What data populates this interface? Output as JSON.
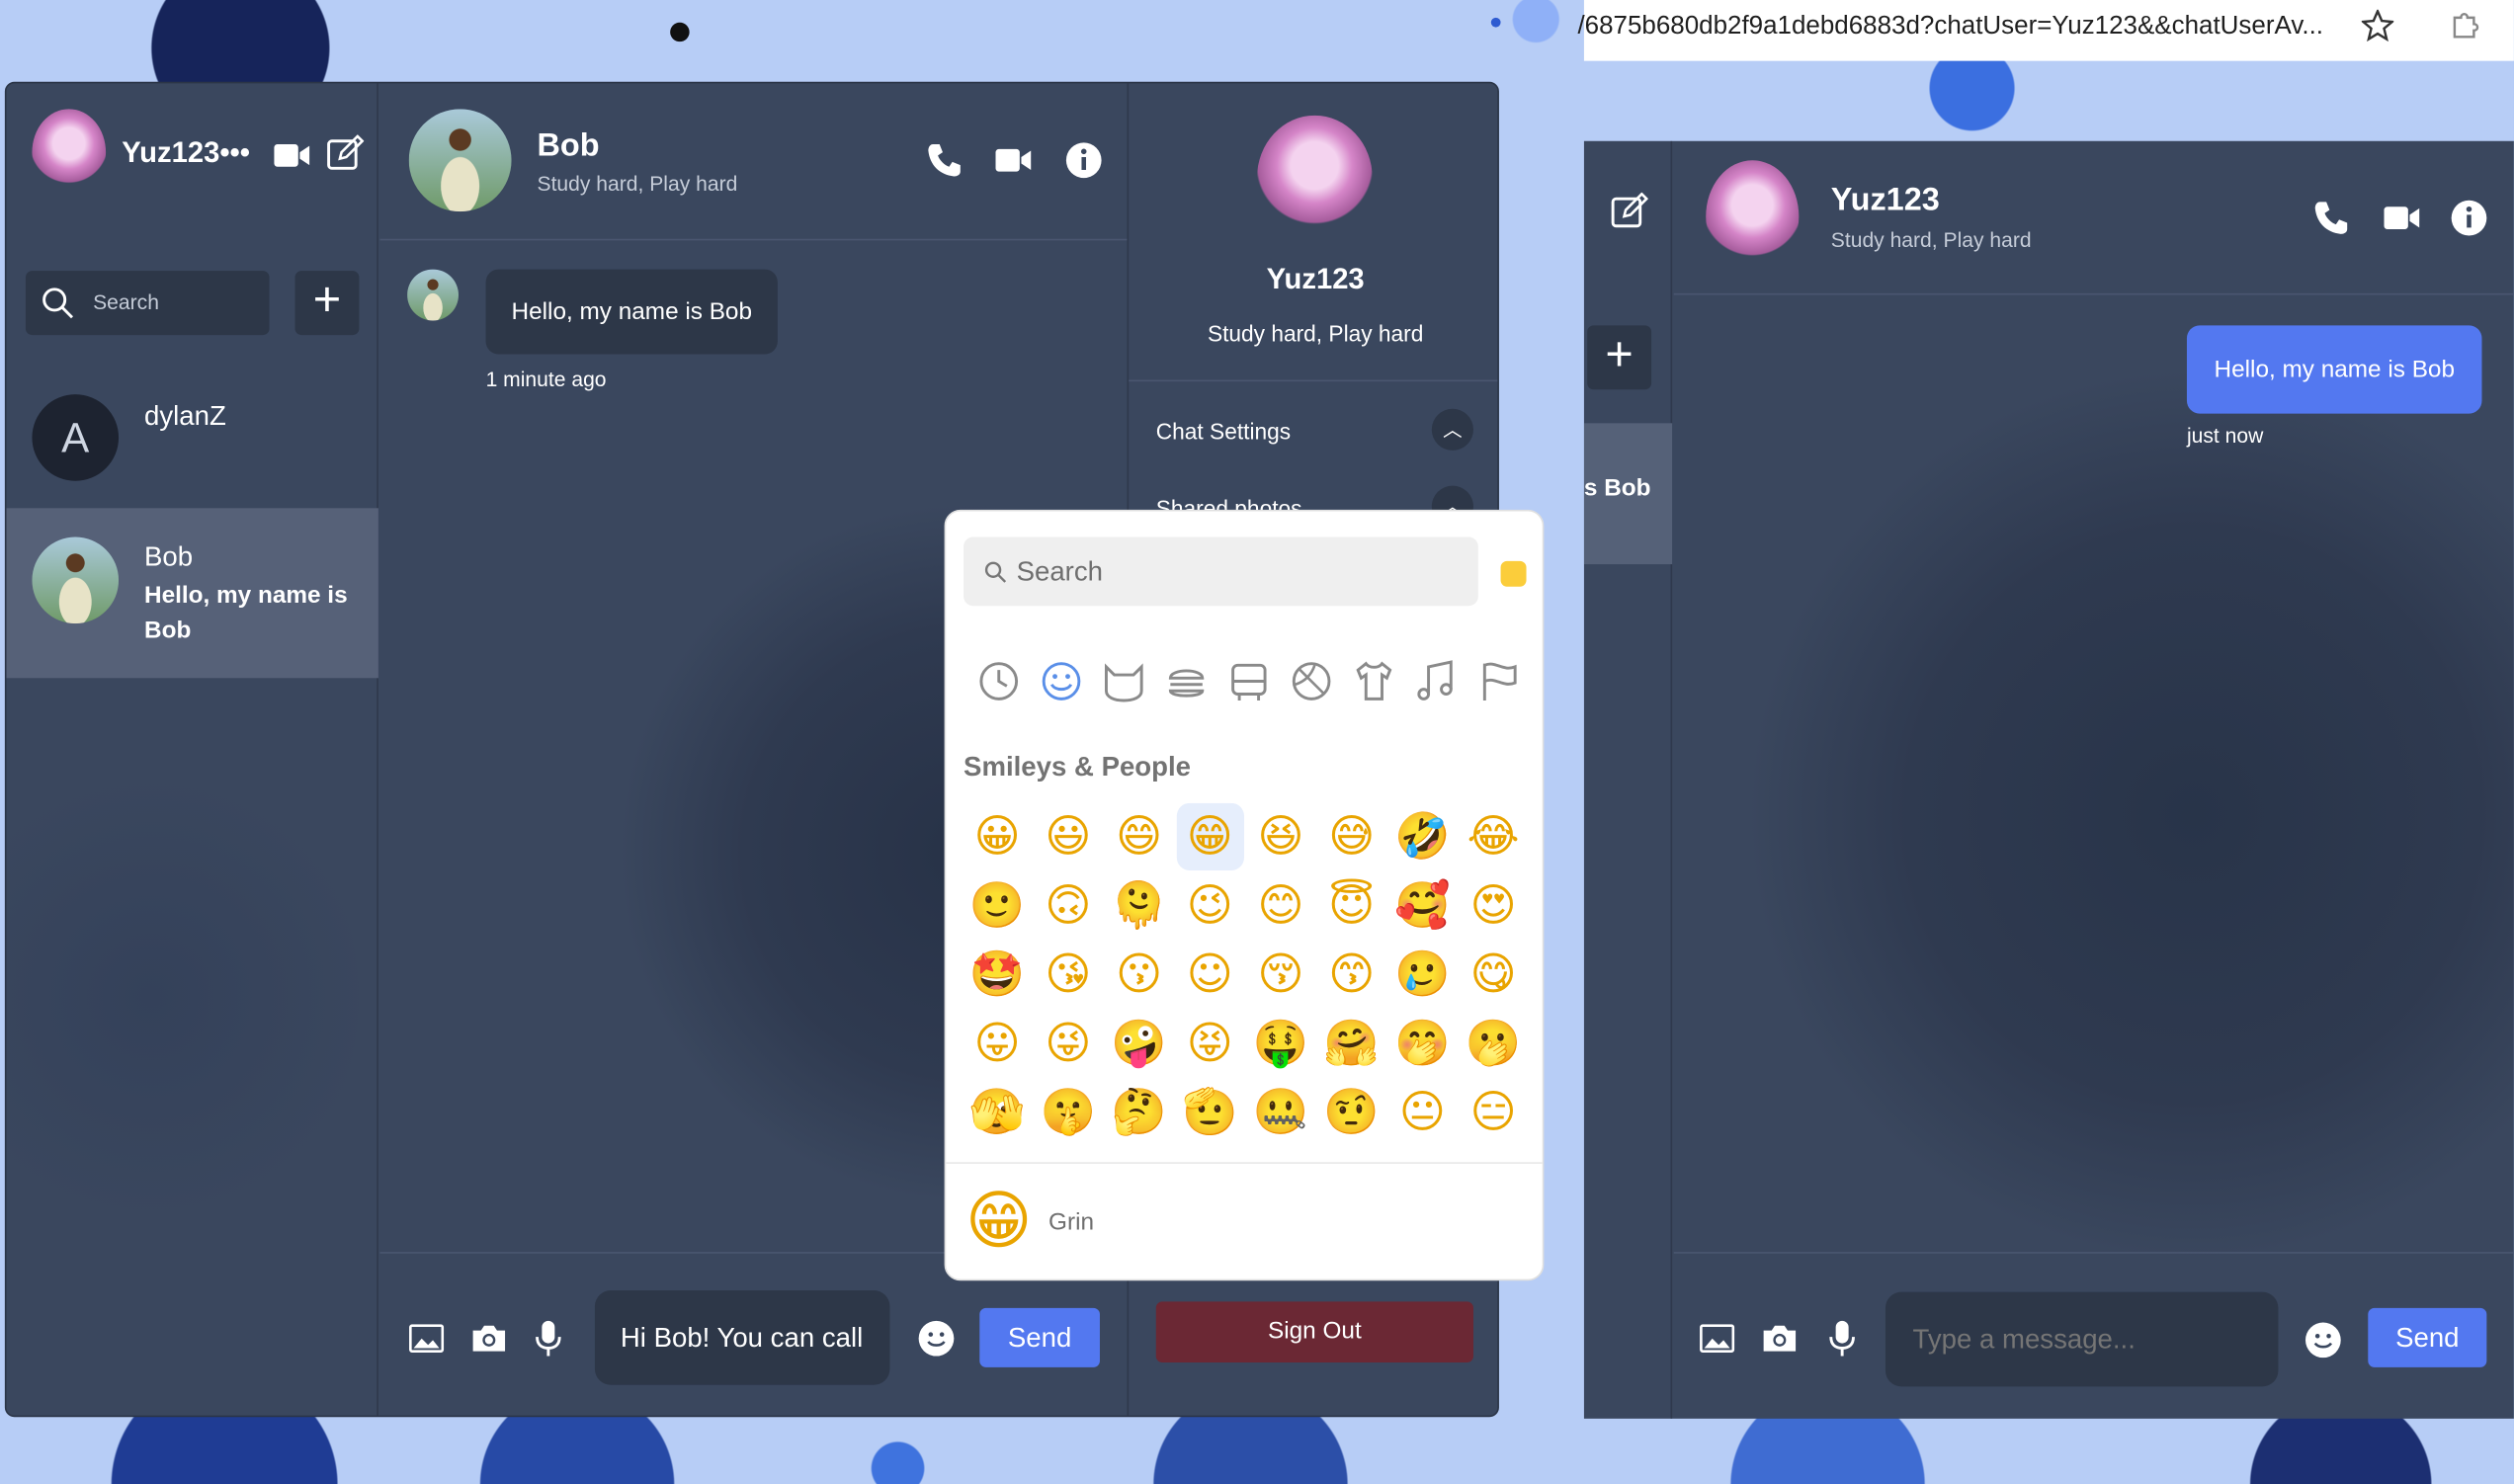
{
  "browser": {
    "url": "/6875b680db2f9a1debd6883d?chatUser=Yuz123&&chatUserAv..."
  },
  "left_window": {
    "sidebar": {
      "username": "Yuz123•••",
      "search_placeholder": "Search",
      "add_label": "+",
      "contacts": [
        {
          "avatar_letter": "A",
          "name": "dylanZ",
          "last_message": ""
        },
        {
          "name": "Bob",
          "last_message": "Hello, my name is Bob",
          "selected": true
        }
      ]
    },
    "chat": {
      "name": "Bob",
      "status": "Study hard, Play hard",
      "messages": [
        {
          "text": "Hello, my name is Bob",
          "time": "1 minute ago"
        }
      ],
      "input_value": "Hi Bob! You can call",
      "send_label": "Send"
    },
    "info_panel": {
      "name": "Yuz123",
      "status": "Study hard, Play hard",
      "sections": [
        "Chat Settings",
        "Shared photos"
      ],
      "sign_out_label": "Sign Out"
    }
  },
  "right_window": {
    "sidebar_fragment": {
      "selected_label": "s Bob",
      "add_label": "+"
    },
    "chat": {
      "name": "Yuz123",
      "status": "Study hard, Play hard",
      "messages": [
        {
          "text": "Hello, my name is Bob",
          "time": "just now"
        }
      ],
      "input_placeholder": "Type a message...",
      "send_label": "Send"
    }
  },
  "emoji_picker": {
    "search_placeholder": "Search",
    "skin_tone_color": "#fbcd3b",
    "categories": [
      "recent-icon",
      "smileys-icon",
      "animals-icon",
      "food-icon",
      "travel-icon",
      "activities-icon",
      "objects-icon",
      "symbols-icon",
      "flags-icon"
    ],
    "section_title": "Smileys & People",
    "emojis": [
      "😀",
      "😃",
      "😄",
      "😁",
      "😆",
      "😅",
      "🤣",
      "😂",
      "🙂",
      "🙃",
      "🫠",
      "😉",
      "😊",
      "😇",
      "🥰",
      "😍",
      "🤩",
      "😘",
      "😗",
      "☺",
      "😚",
      "😙",
      "🥲",
      "😋",
      "😛",
      "😜",
      "🤪",
      "😝",
      "🤑",
      "🤗",
      "🤭",
      "🫢",
      "🫣",
      "🤫",
      "🤔",
      "🫡",
      "🤐",
      "🤨",
      "😐",
      "😑"
    ],
    "selected_index": 3,
    "preview_emoji": "😁",
    "preview_name": "Grin"
  },
  "colors": {
    "accent": "#5378f0",
    "panel": "#3a475e",
    "sign_out": "#6b2834"
  }
}
